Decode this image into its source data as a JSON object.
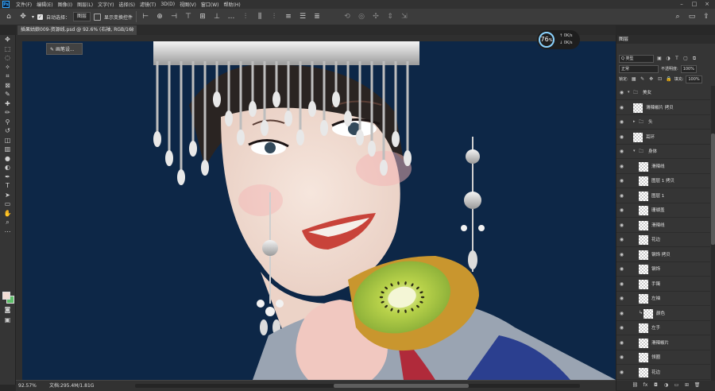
{
  "menu": [
    "文件(F)",
    "编辑(E)",
    "图像(I)",
    "图层(L)",
    "文字(Y)",
    "选择(S)",
    "滤镜(T)",
    "3D(D)",
    "视图(V)",
    "窗口(W)",
    "帮助(H)"
  ],
  "options": {
    "auto_select_label": "自动选择：",
    "auto_select_value": "图层",
    "show_transform_label": "显示变换控件",
    "more_icon": "..."
  },
  "document": {
    "tab_title": "插果姑娘009-资源线.psd @ 92.6% (右袖, RGB/16)",
    "tab_close": "×",
    "tooltip": "画笔设..."
  },
  "efficiency": {
    "dial": "76",
    "dial_unit": "%",
    "line1": "0K/s",
    "line2": "0K/s"
  },
  "status": {
    "zoom": "92.57%",
    "doc": "文档:295.4M/1.81G"
  },
  "layers_panel": {
    "tab": "图层",
    "kind_select": "Q 类型",
    "blend_mode": "正常",
    "opacity_label": "不透明度:",
    "opacity_value": "100%",
    "lock_label": "锁定:",
    "fill_label": "填充:",
    "fill_value": "100%",
    "layers": [
      {
        "name": "美女",
        "type": "group",
        "indent": 0,
        "expanded": true
      },
      {
        "name": "滑辣椒片 拷贝",
        "type": "layer",
        "indent": 1
      },
      {
        "name": "头",
        "type": "group",
        "indent": 1,
        "expanded": false
      },
      {
        "name": "耳环",
        "type": "layer",
        "indent": 1
      },
      {
        "name": "身体",
        "type": "group",
        "indent": 1,
        "expanded": true
      },
      {
        "name": "滑辣线",
        "type": "layer",
        "indent": 2
      },
      {
        "name": "图层 1 拷贝",
        "type": "layer",
        "indent": 2
      },
      {
        "name": "图层 1",
        "type": "layer",
        "indent": 2
      },
      {
        "name": "珊瑚盖",
        "type": "layer",
        "indent": 2
      },
      {
        "name": "滑辣线",
        "type": "layer",
        "indent": 2
      },
      {
        "name": "花边",
        "type": "layer",
        "indent": 2
      },
      {
        "name": "钢饰 拷贝",
        "type": "layer",
        "indent": 2
      },
      {
        "name": "钢饰",
        "type": "layer",
        "indent": 2
      },
      {
        "name": "手镯",
        "type": "layer",
        "indent": 2
      },
      {
        "name": "左袖",
        "type": "layer",
        "indent": 2
      },
      {
        "name": "颜色",
        "type": "layer",
        "indent": 2,
        "clipped": true
      },
      {
        "name": "左手",
        "type": "layer",
        "indent": 2
      },
      {
        "name": "滑辣椒片",
        "type": "layer",
        "indent": 2
      },
      {
        "name": "领圈",
        "type": "layer",
        "indent": 2
      },
      {
        "name": "花边",
        "type": "layer",
        "indent": 2
      }
    ]
  },
  "colors": {
    "canvas_bg": "#0d2747",
    "accent": "#31a8ff",
    "kiwi_flesh": "#b8d24a",
    "kiwi_skin": "#c9962e",
    "lips": "#c8433a",
    "silver": "#c9c9c9"
  }
}
